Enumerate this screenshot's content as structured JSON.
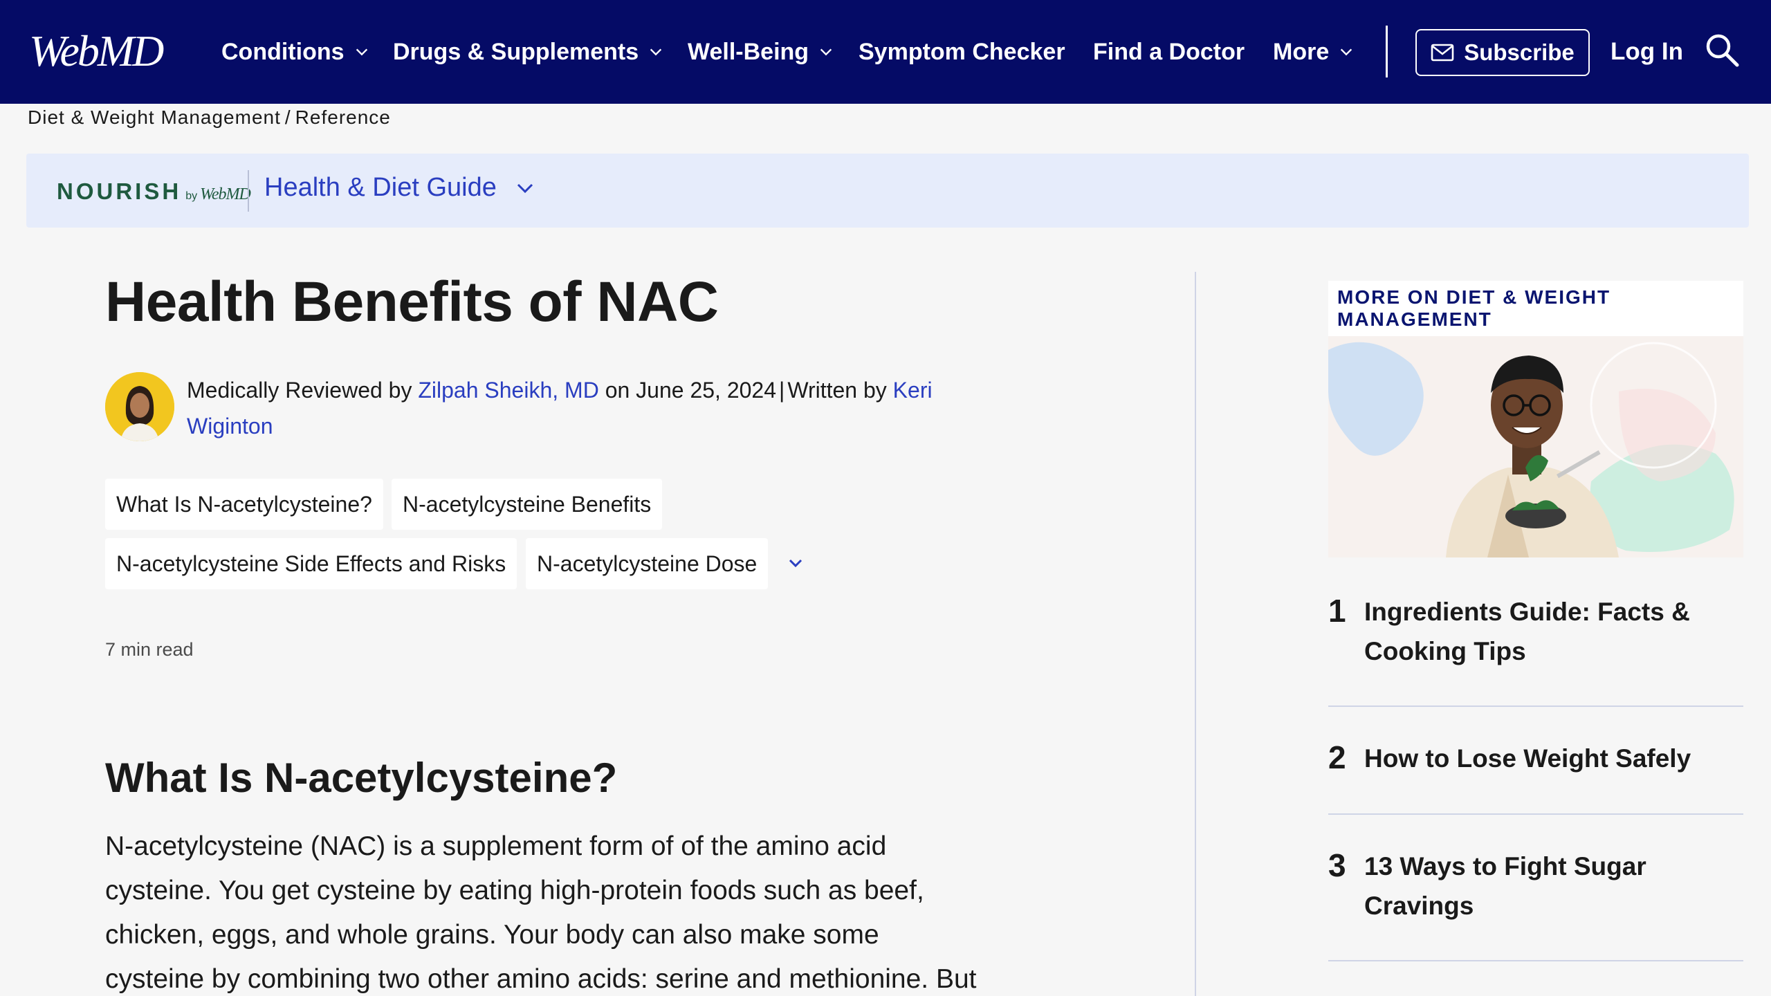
{
  "header": {
    "logo": "WebMD",
    "nav": [
      {
        "label": "Conditions",
        "dropdown": true
      },
      {
        "label": "Drugs & Supplements",
        "dropdown": true
      },
      {
        "label": "Well-Being",
        "dropdown": true
      },
      {
        "label": "Symptom Checker",
        "dropdown": false
      },
      {
        "label": "Find a Doctor",
        "dropdown": false
      },
      {
        "label": "More",
        "dropdown": true
      }
    ],
    "subscribe_label": "Subscribe",
    "login_label": "Log In",
    "search_icon": "search-icon",
    "bg_color": "#050b66"
  },
  "breadcrumb": {
    "items": [
      "Diet & Weight Management",
      "Reference"
    ],
    "separator": "/"
  },
  "nourish_banner": {
    "brand": "NOURISH",
    "by": "by",
    "brand_suffix": "WebMD",
    "guide_label": "Health & Diet Guide",
    "bg_color": "#e6ecfb"
  },
  "article": {
    "title": "Health Benefits of NAC",
    "byline": {
      "reviewed_prefix": "Medically Reviewed by",
      "reviewer": "Zilpah Sheikh, MD",
      "date_text": "on June 25, 2024",
      "separator": "|",
      "written_prefix": "Written by",
      "author": "Keri Wiginton"
    },
    "toc_chips": [
      "What Is N-acetylcysteine?",
      "N-acetylcysteine Benefits",
      "N-acetylcysteine Side Effects and Risks",
      "N-acetylcysteine Dose"
    ],
    "read_time": "7 min read",
    "section_heading": "What Is N-acetylcysteine?",
    "body_lines": [
      "N-acetylcysteine (NAC) is a supplement form of of the amino acid",
      "cysteine. You get cysteine by eating high-protein foods such as beef,",
      "chicken, eggs, and whole grains. Your body can also make some",
      "cysteine by combining two other amino acids: serine and methionine. But"
    ],
    "link_color": "#2a3ec0"
  },
  "sidebar": {
    "heading": "MORE ON DIET & WEIGHT MANAGEMENT",
    "items": [
      {
        "num": "1",
        "title": "Ingredients Guide: Facts & Cooking Tips"
      },
      {
        "num": "2",
        "title": "How to Lose Weight Safely"
      },
      {
        "num": "3",
        "title": "13 Ways to Fight Sugar Cravings"
      }
    ]
  }
}
